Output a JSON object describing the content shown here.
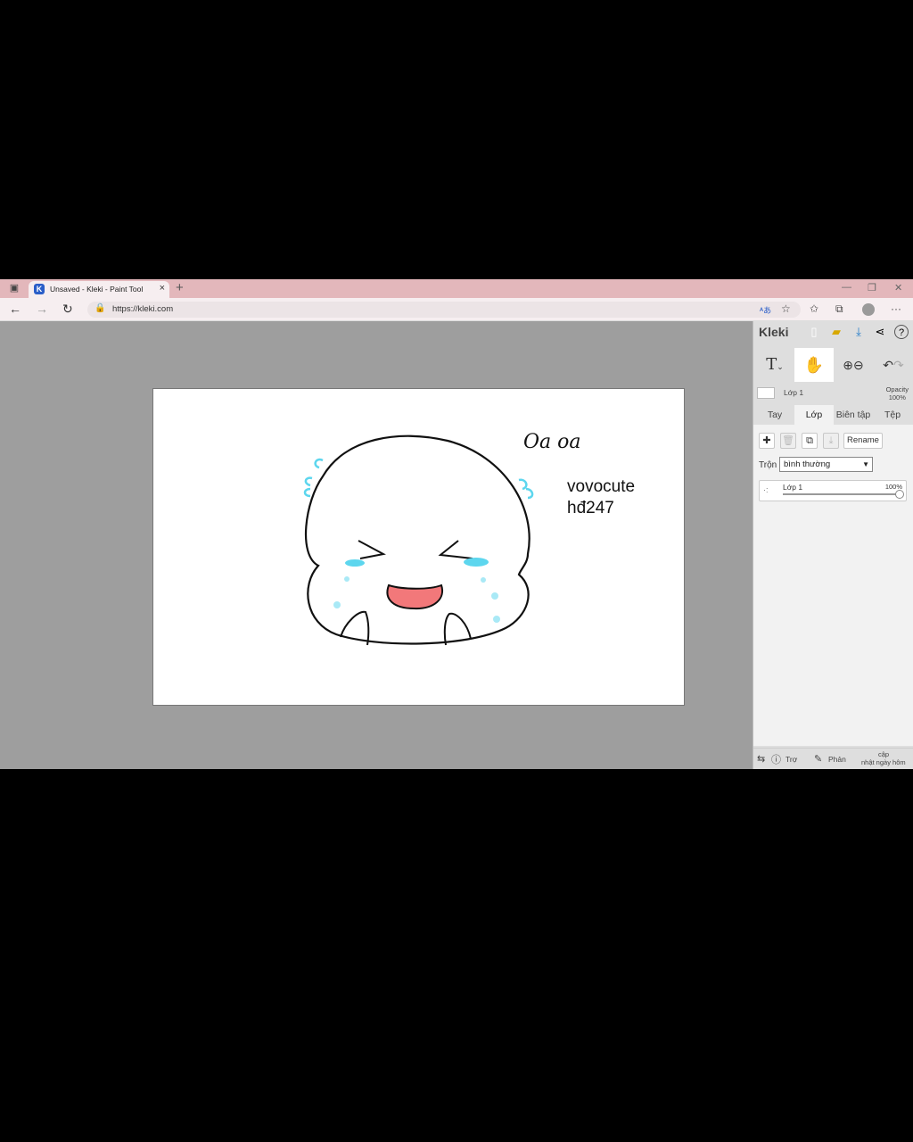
{
  "browser": {
    "tab_title": "Unsaved - Kleki - Paint Tool",
    "tab_close": "×",
    "new_tab": "+",
    "url": "https://kleki.com"
  },
  "canvas": {
    "title_text": "Oa oa",
    "caption_line1": "vovocute",
    "caption_line2": "hđ247",
    "colors": {
      "tear": "#5dd6ee",
      "mouth": "#f2787a"
    }
  },
  "panel": {
    "logo": "Kleki",
    "tool_text": "T",
    "layer_mini": {
      "name": "Lớp 1",
      "opacity_label": "Opacity",
      "opacity_value": "100%"
    },
    "tabs": [
      "Tay",
      "Lớp",
      "Biên tập",
      "Tệp"
    ],
    "active_tab": "Lớp",
    "rename_label": "Rename",
    "blend_label": "Trộn",
    "blend_value": "bình thường",
    "layer": {
      "name": "Lớp 1",
      "opacity": "100%"
    },
    "footer": {
      "help": "Trợ",
      "feedback": "Phản",
      "update_line1": "cập",
      "update_line2": "nhật ngày hôm"
    }
  }
}
